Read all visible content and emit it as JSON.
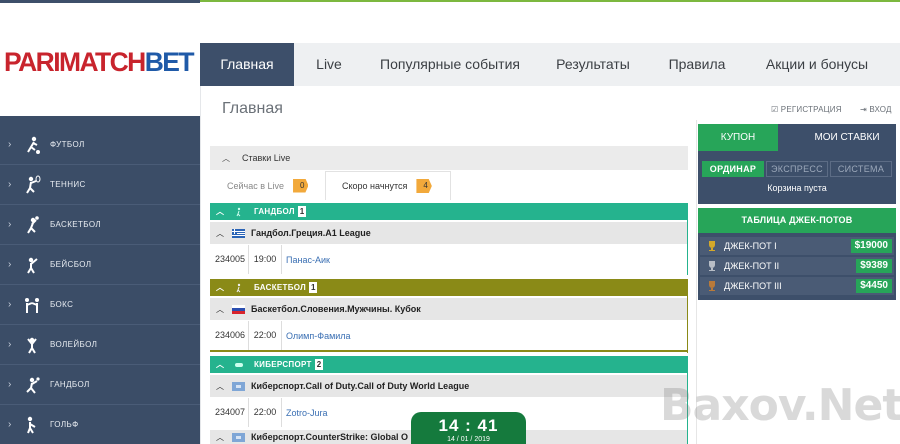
{
  "brand": {
    "part1": "PARIMATCH",
    "part2": "BET"
  },
  "nav": [
    {
      "label": "Главная"
    },
    {
      "label": "Live"
    },
    {
      "label": "Популярные события"
    },
    {
      "label": "Результаты"
    },
    {
      "label": "Правила"
    },
    {
      "label": "Акции и бонусы"
    }
  ],
  "page": {
    "title": "Главная",
    "register": "☑ РЕГИСТРАЦИЯ",
    "login": "⇥ ВХОД"
  },
  "sidebar": [
    {
      "label": "ФУТБОЛ",
      "icon": "football-icon"
    },
    {
      "label": "ТЕННИС",
      "icon": "tennis-icon"
    },
    {
      "label": "БАСКЕТБОЛ",
      "icon": "basketball-icon"
    },
    {
      "label": "БЕЙСБОЛ",
      "icon": "baseball-icon"
    },
    {
      "label": "БОКС",
      "icon": "boxing-icon"
    },
    {
      "label": "ВОЛЕЙБОЛ",
      "icon": "volleyball-icon"
    },
    {
      "label": "ГАНДБОЛ",
      "icon": "handball-icon"
    },
    {
      "label": "ГОЛЬФ",
      "icon": "golf-icon"
    }
  ],
  "live": {
    "header": "Ставки Live",
    "tab_now": "Сейчас в Live",
    "tab_now_count": "0",
    "tab_soon": "Скоро начнутся",
    "tab_soon_count": "4"
  },
  "sports": [
    {
      "name": "ГАНДБОЛ",
      "count": "1",
      "color": "#25b38e",
      "league": "Гандбол.Греция.А1 League",
      "event_id": "234005",
      "time": "19:00",
      "event": "Панас-Аик"
    },
    {
      "name": "БАСКЕТБОЛ",
      "count": "1",
      "color": "#8a8a17",
      "league": "Баскетбол.Словения.Мужчины. Кубок",
      "event_id": "234006",
      "time": "22:00",
      "event": "Олимп-Фамила"
    },
    {
      "name": "КИБЕРСПОРТ",
      "count": "2",
      "color": "#25b38e",
      "league": "Киберспорт.Call of Duty.Call of Duty World League",
      "event_id": "234007",
      "time": "22:00",
      "event": "Zotro-Jura"
    },
    {
      "league": "Киберспорт.CounterStrike: Global O"
    }
  ],
  "coupon": {
    "tab_coupon": "КУПОН",
    "tab_mybets": "МОИ СТАВКИ",
    "type_single": "ОРДИНАР",
    "type_express": "ЭКСПРЕСС",
    "type_system": "СИСТЕМА",
    "empty": "Корзина пуста"
  },
  "jackpots": {
    "title": "ТАБЛИЦА ДЖЕК-ПОТОВ",
    "items": [
      {
        "label": "ДЖЕК-ПОТ I",
        "value": "$19000",
        "cup": "#d4a82a"
      },
      {
        "label": "ДЖЕК-ПОТ II",
        "value": "$9389",
        "cup": "#b7bdc6"
      },
      {
        "label": "ДЖЕК-ПОТ III",
        "value": "$4450",
        "cup": "#b87a3a"
      }
    ]
  },
  "clock": {
    "time": "14 : 41",
    "date": "14 / 01 / 2019"
  },
  "watermark": "Baxov.Net"
}
